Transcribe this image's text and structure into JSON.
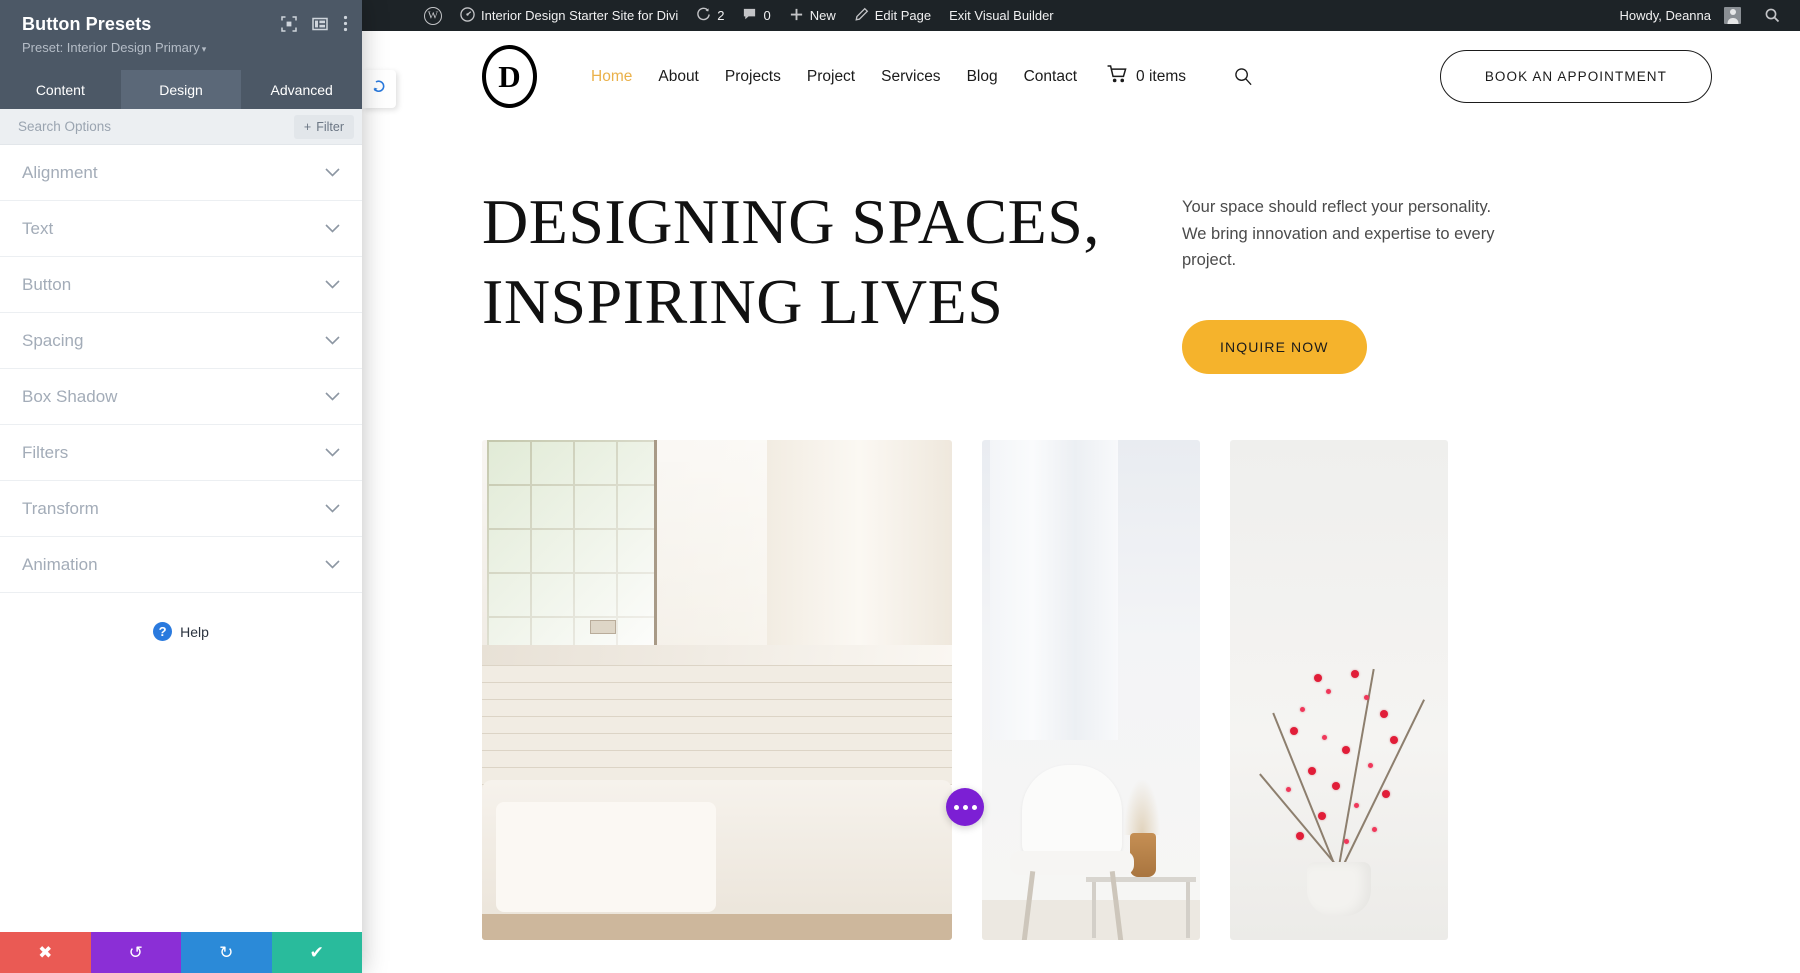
{
  "adminbar": {
    "wp_logo": "wordpress-logo-icon",
    "site_name": "Interior Design Starter Site for Divi",
    "updates_count": "2",
    "comments_count": "0",
    "new_label": "New",
    "edit_page_label": "Edit Page",
    "exit_builder_label": "Exit Visual Builder",
    "howdy": "Howdy, Deanna",
    "search_icon": "search-icon"
  },
  "panel": {
    "title": "Button Presets",
    "subtitle": "Preset: Interior Design Primary",
    "caret": "▾",
    "head_icons": [
      "expand-icon",
      "layout-icon",
      "more-vertical-icon"
    ],
    "tabs": [
      {
        "label": "Content",
        "active": false
      },
      {
        "label": "Design",
        "active": true
      },
      {
        "label": "Advanced",
        "active": false
      }
    ],
    "search_placeholder": "Search Options",
    "search_value": "",
    "filter_label": "Filter",
    "filter_plus": "+",
    "sections": [
      {
        "label": "Alignment"
      },
      {
        "label": "Text"
      },
      {
        "label": "Button"
      },
      {
        "label": "Spacing"
      },
      {
        "label": "Box Shadow"
      },
      {
        "label": "Filters"
      },
      {
        "label": "Transform"
      },
      {
        "label": "Animation"
      }
    ],
    "chevron": "⌄",
    "help_label": "Help",
    "help_glyph": "?",
    "actions": [
      {
        "name": "discard-changes",
        "glyph": "✖",
        "color": "#ea5a54"
      },
      {
        "name": "undo",
        "glyph": "↺",
        "color": "#8b2fd6"
      },
      {
        "name": "redo",
        "glyph": "↻",
        "color": "#2b8ad8"
      },
      {
        "name": "save-changes",
        "glyph": "✔",
        "color": "#29bb9c"
      }
    ],
    "handle_glyph": "⤻"
  },
  "site": {
    "logo_letter": "D",
    "nav": [
      {
        "label": "Home",
        "active": true
      },
      {
        "label": "About",
        "active": false
      },
      {
        "label": "Projects",
        "active": false
      },
      {
        "label": "Project",
        "active": false
      },
      {
        "label": "Services",
        "active": false
      },
      {
        "label": "Blog",
        "active": false
      },
      {
        "label": "Contact",
        "active": false
      }
    ],
    "cart_label": "0 items",
    "appointment_label": "BOOK AN APPOINTMENT",
    "hero_heading": "DESIGNING SPACES, INSPIRING LIVES",
    "hero_paragraph": "Your space should reflect your personality. We bring innovation and expertise to every project.",
    "inquire_label": "INQUIRE NOW",
    "accent_color": "#f5b32c",
    "nav_active_color": "#eab14a"
  },
  "fab": {
    "name": "page-settings-fab",
    "glyph": "•••",
    "color": "#7c1fd4"
  }
}
